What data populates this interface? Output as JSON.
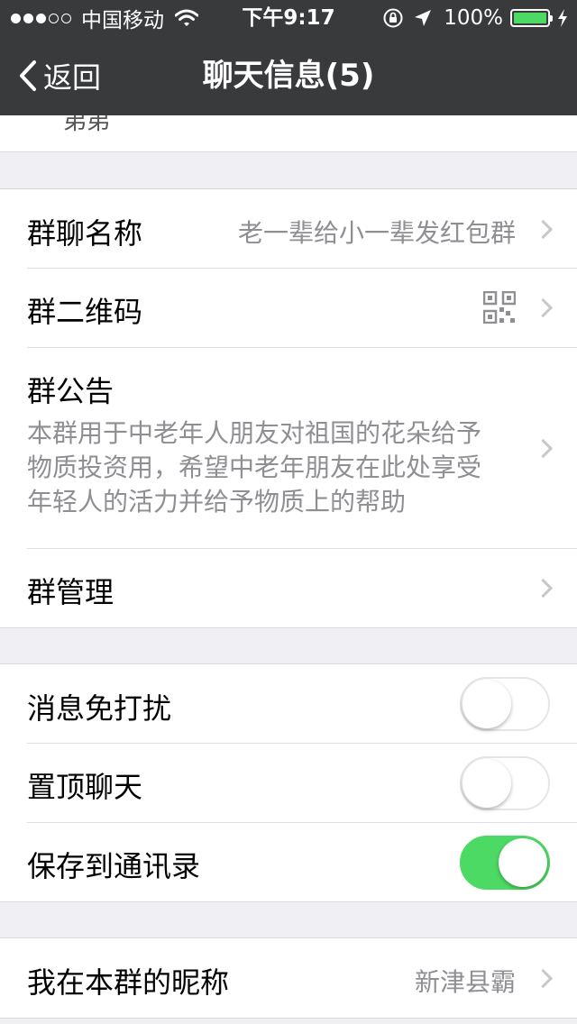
{
  "status_bar": {
    "carrier": "中国移动",
    "time": "下午9:17",
    "battery_text": "100%",
    "signal_dots_filled": 3,
    "signal_dots_total": 5,
    "battery_level_percent": 100,
    "colors": {
      "battery_fill": "#4cd964"
    }
  },
  "nav": {
    "back_label": "返回",
    "title": "聊天信息(5)"
  },
  "peek_text": "弟弟",
  "group_info": {
    "name_label": "群聊名称",
    "name_value": "老一辈给小一辈发红包群",
    "qrcode_label": "群二维码",
    "announcement_label": "群公告",
    "announcement_text": "本群用于中老年人朋友对祖国的花朵给予物质投资用，希望中老年朋友在此处享受年轻人的活力并给予物质上的帮助",
    "manage_label": "群管理"
  },
  "settings": {
    "mute_label": "消息免打扰",
    "mute_on": false,
    "pin_label": "置顶聊天",
    "pin_on": false,
    "save_label": "保存到通讯录",
    "save_on": true
  },
  "nickname": {
    "label": "我在本群的昵称",
    "value": "新津县霸"
  },
  "icons": [
    "wifi-icon",
    "orientation-lock-icon",
    "location-arrow-icon",
    "charging-bolt-icon",
    "back-chevron-icon",
    "qr-code-icon",
    "chevron-right-icon"
  ],
  "colors": {
    "nav_bg": "#383a3c",
    "page_bg": "#efeff4",
    "toggle_on": "#4cd964",
    "secondary_text": "#8e8e93"
  }
}
